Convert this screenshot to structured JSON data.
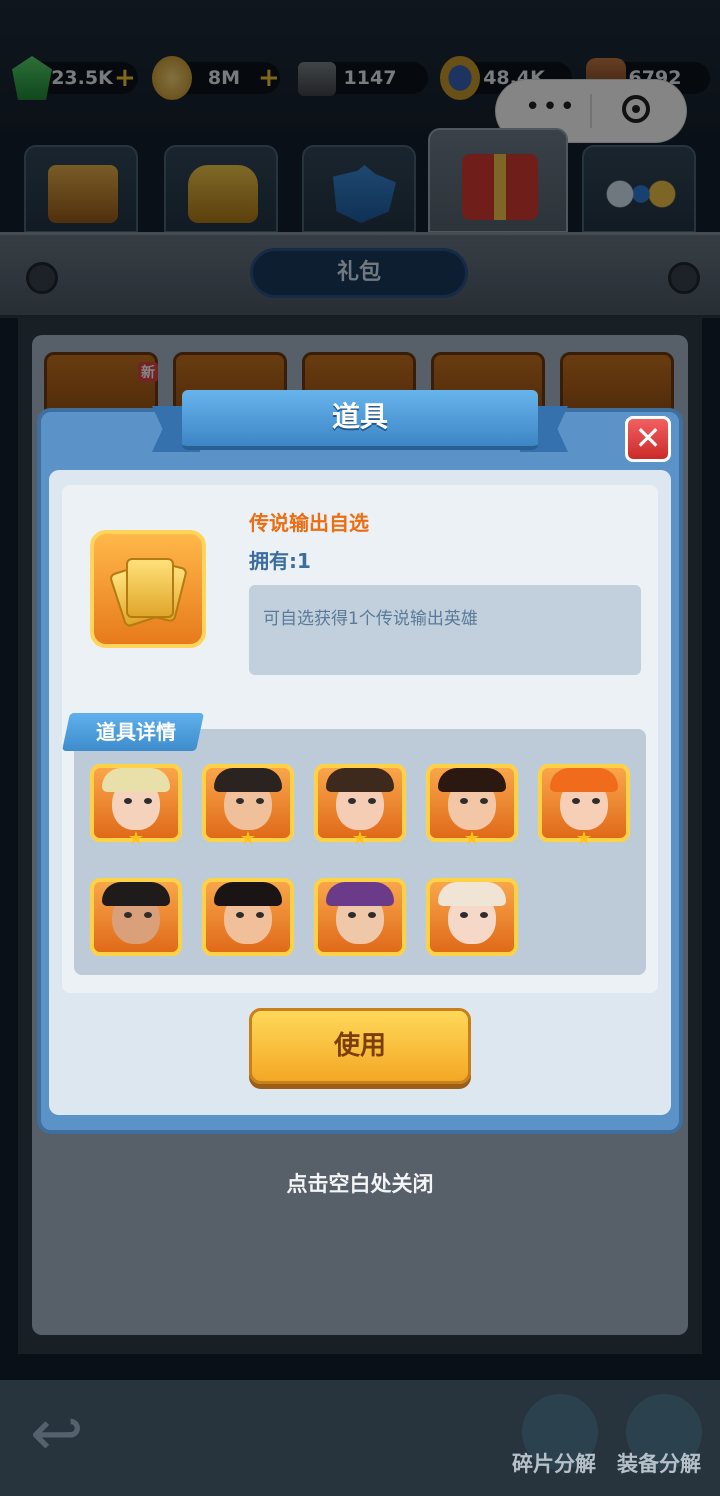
{
  "resources": [
    {
      "name": "gem",
      "value": "23.5K",
      "plus": true,
      "color": "#38b24f"
    },
    {
      "name": "coin",
      "value": "8M",
      "plus": true,
      "color": "#d9b23b"
    },
    {
      "name": "iron",
      "value": "1147",
      "plus": false,
      "color": "#6b6f75"
    },
    {
      "name": "medal",
      "value": "48.4K",
      "plus": false,
      "color": "#c99a2b"
    },
    {
      "name": "wood",
      "value": "6792",
      "plus": false,
      "color": "#9b5c2c"
    }
  ],
  "capsule": {
    "more": "•••",
    "target": "◉"
  },
  "page_title": "礼包",
  "new_badge": "新",
  "dialog": {
    "title": "道具",
    "close": "✕",
    "item_name": "传说输出自选",
    "owned": "拥有:1",
    "description": "可自选获得1个传说输出英雄",
    "details_label": "道具详情",
    "use_button": "使用"
  },
  "heroes": [
    {
      "hair": "#e8e0a8",
      "skin": "#f4d2bb",
      "star": "★"
    },
    {
      "hair": "#2a2320",
      "skin": "#f0c09a",
      "star": "★"
    },
    {
      "hair": "#3d2a1d",
      "skin": "#f5cdb4",
      "star": "★"
    },
    {
      "hair": "#2b1810",
      "skin": "#f3c7a6",
      "star": "★"
    },
    {
      "hair": "#f06c1c",
      "skin": "#f7cfb6",
      "star": "★"
    },
    {
      "hair": "#1e1b1a",
      "skin": "#d9a07a",
      "star": ""
    },
    {
      "hair": "#1a1514",
      "skin": "#f1c09a",
      "star": ""
    },
    {
      "hair": "#6b3b8a",
      "skin": "#efc7a9",
      "star": ""
    },
    {
      "hair": "#f0e4d4",
      "skin": "#f6d8c8",
      "star": ""
    }
  ],
  "close_hint": "点击空白处关闭",
  "bottom": {
    "back": "↩",
    "fragment_label": "碎片分解",
    "equip_label": "装备分解"
  }
}
